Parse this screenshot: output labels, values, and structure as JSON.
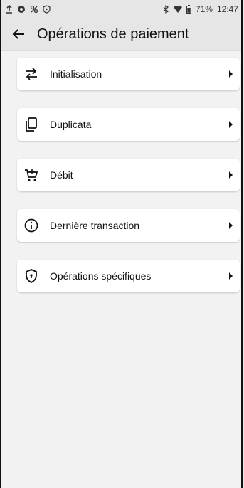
{
  "status_bar": {
    "battery": "71%",
    "time": "12:47"
  },
  "app_bar": {
    "title": "Opérations de paiement"
  },
  "menu": {
    "items": [
      {
        "label": "Initialisation",
        "icon": "swap-arrows-icon"
      },
      {
        "label": "Duplicata",
        "icon": "copy-icon"
      },
      {
        "label": "Débit",
        "icon": "cart-add-icon"
      },
      {
        "label": "Dernière transaction",
        "icon": "info-icon"
      },
      {
        "label": "Opérations spécifiques",
        "icon": "shield-icon"
      }
    ]
  }
}
